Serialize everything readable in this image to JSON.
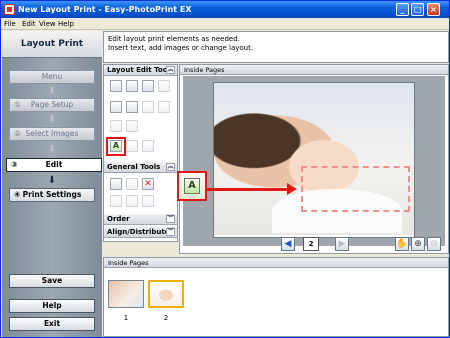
{
  "window": {
    "title": "New Layout Print - Easy-PhotoPrint EX",
    "controls": {
      "minimize": "_",
      "maximize": "□",
      "close": "×"
    }
  },
  "menubar": {
    "items": [
      "File",
      "Edit",
      "View",
      "Help"
    ]
  },
  "left_panel": {
    "title": "Layout Print",
    "steps": [
      {
        "num": "",
        "label": "Menu"
      },
      {
        "num": "①",
        "label": "Page Setup"
      },
      {
        "num": "②",
        "label": "Select Images"
      },
      {
        "num": "③",
        "label": "Edit"
      },
      {
        "num": "④",
        "label": "Print Settings"
      }
    ],
    "buttons": {
      "save": "Save",
      "help": "Help",
      "exit": "Exit"
    }
  },
  "instructions": {
    "line1": "Edit layout print elements as needed.",
    "line2": "Insert text, add images or change layout."
  },
  "tools_panel": {
    "layout_edit_title": "Layout Edit Tools",
    "general_title": "General Tools",
    "order_label": "Order",
    "align_label": "Align/Distribute",
    "text_tool_glyph": "A"
  },
  "main_panel": {
    "title": "Inside Pages"
  },
  "pager": {
    "page": "2"
  },
  "thumbnails": {
    "title": "Inside Pages",
    "items": [
      {
        "num": "1"
      },
      {
        "num": "2"
      }
    ]
  },
  "colors": {
    "highlight": "#e01818",
    "titlebar": "#0a5fd8",
    "selected_thumb": "#f1b000"
  }
}
